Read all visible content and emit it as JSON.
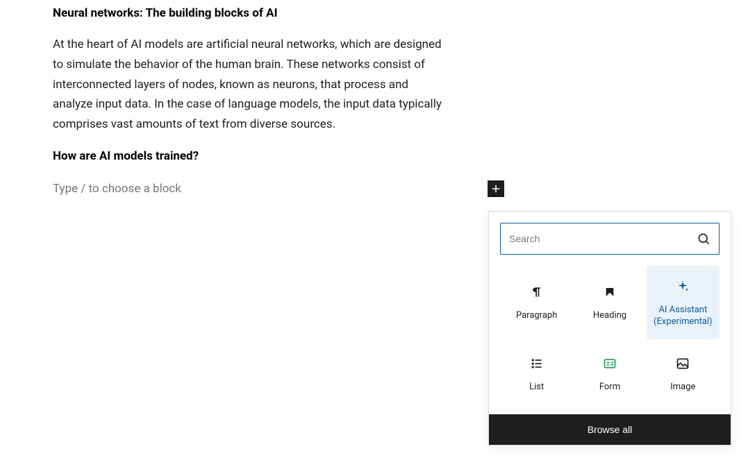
{
  "content": {
    "heading1": "Neural networks: The building blocks of AI",
    "paragraph1": "At the heart of AI models are artificial neural networks, which are designed to simulate the behavior of the human brain. These networks consist of interconnected layers of nodes, known as neurons, that process and analyze input data. In the case of language models, the input data typically comprises vast amounts of text from diverse sources.",
    "heading2": "How are AI models trained?",
    "block_placeholder": "Type / to choose a block"
  },
  "inserter": {
    "search_placeholder": "Search",
    "blocks": [
      {
        "label": "Paragraph"
      },
      {
        "label": "Heading"
      },
      {
        "label": "AI Assistant (Experimental)"
      },
      {
        "label": "List"
      },
      {
        "label": "Form"
      },
      {
        "label": "Image"
      }
    ],
    "browse_all": "Browse all"
  }
}
